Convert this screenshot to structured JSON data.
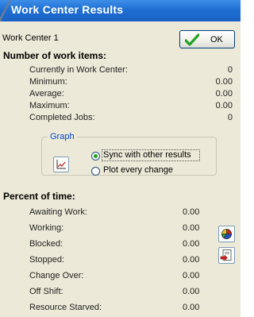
{
  "window": {
    "title": "Work Center Results"
  },
  "header": {
    "work_center_name": "Work Center 1",
    "ok_label": "OK"
  },
  "work_items": {
    "heading": "Number of work items:",
    "rows": [
      {
        "label": "Currently in Work Center:",
        "value": "0"
      },
      {
        "label": "Minimum:",
        "value": "0.00"
      },
      {
        "label": "Average:",
        "value": "0.00"
      },
      {
        "label": "Maximum:",
        "value": "0.00"
      },
      {
        "label": "Completed Jobs:",
        "value": "0"
      }
    ]
  },
  "graph": {
    "group_label": "Graph",
    "options": [
      {
        "label": "Sync with other results",
        "selected": true
      },
      {
        "label": "Plot every change",
        "selected": false
      }
    ]
  },
  "percent_time": {
    "heading": "Percent of time:",
    "rows": [
      {
        "label": "Awaiting Work:",
        "value": "0.00"
      },
      {
        "label": "Working:",
        "value": "0.00"
      },
      {
        "label": "Blocked:",
        "value": "0.00"
      },
      {
        "label": "Stopped:",
        "value": "0.00"
      },
      {
        "label": "Change Over:",
        "value": "0.00"
      },
      {
        "label": "Off Shift:",
        "value": "0.00"
      },
      {
        "label": "Resource Starved:",
        "value": "0.00"
      }
    ]
  },
  "icons": {
    "graph_button": "line-chart-icon",
    "pie_button": "pie-chart-icon",
    "export_button": "document-export-icon",
    "ok_icon": "check-icon"
  },
  "colors": {
    "titlebar": "#1f6fd3",
    "client_bg": "#ece9d8",
    "check": "#21a121",
    "group_label": "#0046d5"
  }
}
